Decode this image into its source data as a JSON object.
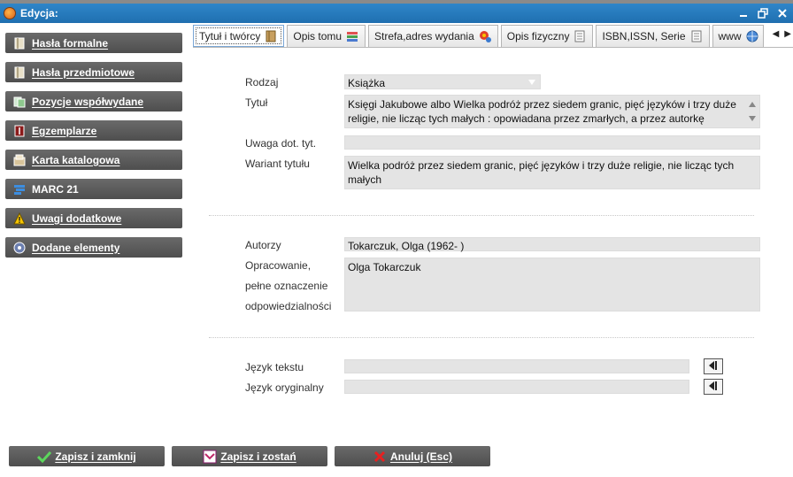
{
  "window": {
    "title": "Edycja:"
  },
  "sidebar": {
    "items": [
      {
        "label": "Hasła formalne",
        "icon": "book-icon"
      },
      {
        "label": "Hasła przedmiotowe",
        "icon": "book-icon"
      },
      {
        "label": "Pozycje współwydane",
        "icon": "linked-items-icon"
      },
      {
        "label": "Egzemplarze",
        "icon": "copies-icon"
      },
      {
        "label": "Karta katalogowa",
        "icon": "catalog-card-icon"
      },
      {
        "label": "MARC 21",
        "icon": "marc-icon"
      },
      {
        "label": "Uwagi dodatkowe",
        "icon": "warning-icon"
      },
      {
        "label": "Dodane elementy",
        "icon": "disc-icon"
      }
    ]
  },
  "tabs": [
    {
      "label": "Tytuł i twórcy",
      "icon": "book-icon",
      "active": true
    },
    {
      "label": "Opis tomu",
      "icon": "stack-icon",
      "active": false
    },
    {
      "label": "Strefa,adres wydania",
      "icon": "location-icon",
      "active": false
    },
    {
      "label": "Opis fizyczny",
      "icon": "document-icon",
      "active": false
    },
    {
      "label": "ISBN,ISSN, Serie",
      "icon": "document-icon",
      "active": false
    },
    {
      "label": "www",
      "icon": "globe-icon",
      "active": false
    }
  ],
  "form": {
    "rodzaj": {
      "label": "Rodzaj",
      "value": "Książka"
    },
    "tytul": {
      "label": "Tytuł",
      "value": "Księgi Jakubowe albo Wielka podróż przez siedem granic, pięć języków i trzy duże religie, nie licząc tych małych : opowiadana przez zmarłych, a przez autorkę dopełniona metodą koniektury, z wielu rozmaitych ksiąg zaczerpnięta, a także"
    },
    "uwaga": {
      "label": "Uwaga dot. tyt.",
      "value": ""
    },
    "wariant": {
      "label": "Wariant tytułu",
      "value": "Wielka podróż przez siedem granic, pięć języków i trzy duże religie, nie licząc tych małych"
    },
    "autorzy": {
      "label": "Autorzy",
      "value": "Tokarczuk, Olga (1962- )"
    },
    "opracowanie": {
      "label_lines": [
        "Opracowanie,",
        "pełne oznaczenie",
        "odpowiedzialności"
      ],
      "value": "Olga Tokarczuk"
    },
    "jezyk_tekstu": {
      "label": "Język tekstu",
      "value": ""
    },
    "jezyk_oryginalny": {
      "label": "Język oryginalny",
      "value": ""
    }
  },
  "buttons": {
    "save_close": {
      "label": "Zapisz i zamknij",
      "icon": "checkmark-icon"
    },
    "save_stay": {
      "label": "Zapisz i zostań",
      "icon": "save-stay-icon"
    },
    "cancel": {
      "label": "Anuluj (Esc)",
      "icon": "cross-icon"
    }
  },
  "colors": {
    "titlebar": "#1f6fb0",
    "sidebar_button": "#5a5a5a",
    "field_bg": "#e4e4e4"
  }
}
